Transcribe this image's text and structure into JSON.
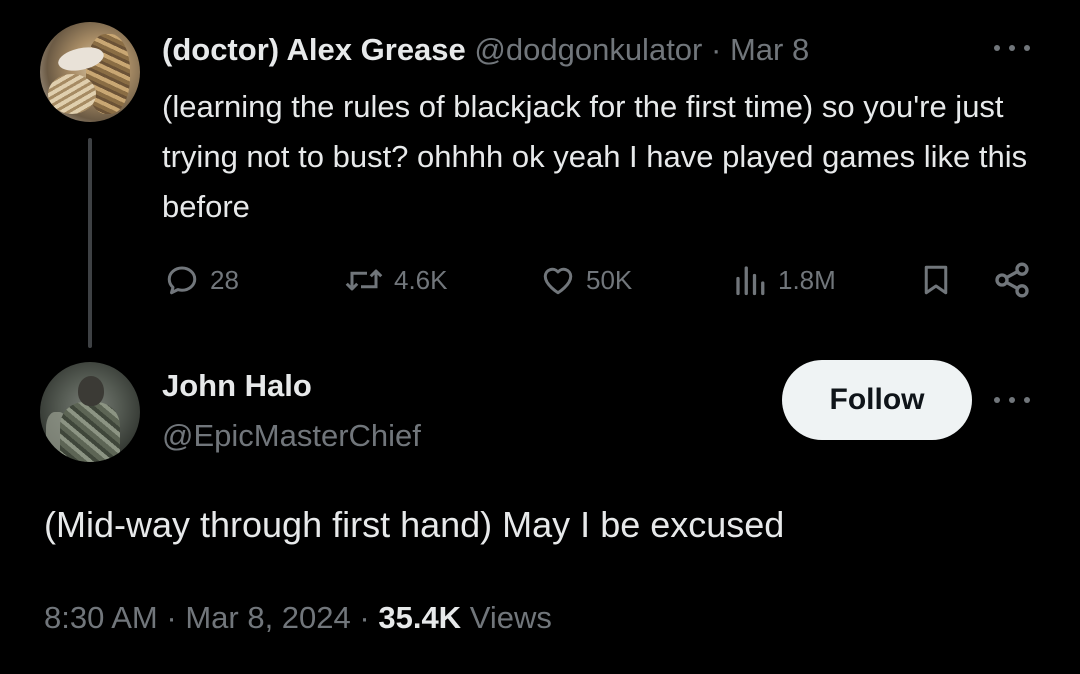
{
  "parent_tweet": {
    "display_name": "(doctor) Alex Grease",
    "handle": "@dodgonkulator",
    "separator": "·",
    "date": "Mar 8",
    "text": "(learning the rules of blackjack for the first time) so you're just trying not to bust? ohhhh ok yeah I have played games like this before",
    "actions": {
      "replies": "28",
      "reposts": "4.6K",
      "likes": "50K",
      "views": "1.8M"
    }
  },
  "reply_tweet": {
    "display_name": "John Halo",
    "handle": "@EpicMasterChief",
    "follow_label": "Follow",
    "text": "(Mid-way through first hand) May I be excused",
    "time": "8:30 AM",
    "separator": "·",
    "date": "Mar 8, 2024",
    "views_count": "35.4K",
    "views_label": "Views"
  },
  "colors": {
    "background": "#000000",
    "text": "#e7e9ea",
    "muted": "#71767b",
    "follow_bg": "#eff3f4"
  },
  "icons": [
    "more-icon",
    "reply-icon",
    "repost-icon",
    "like-icon",
    "views-icon",
    "bookmark-icon",
    "share-icon"
  ]
}
